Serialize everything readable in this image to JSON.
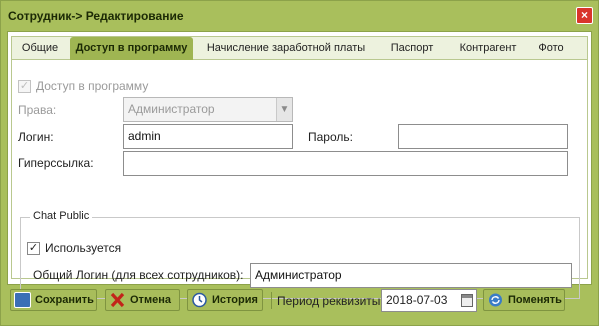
{
  "window": {
    "title": "Сотрудник-> Редактирование",
    "close": "×"
  },
  "tabs": [
    {
      "label": "Общие"
    },
    {
      "label": "Доступ в программу"
    },
    {
      "label": "Начисление заработной платы"
    },
    {
      "label": "Паспорт"
    },
    {
      "label": "Контрагент"
    },
    {
      "label": "Фото"
    }
  ],
  "form": {
    "access_label": "Доступ в программу",
    "rights_label": "Права:",
    "rights_value": "Администратор",
    "login_label": "Логин:",
    "login_value": "admin",
    "password_label": "Пароль:",
    "password_value": "",
    "hyperlink_label": "Гиперссылка:",
    "hyperlink_value": ""
  },
  "chat": {
    "legend": "Chat Public",
    "used_label": "Используется",
    "common_login_label": "Общий Логин (для всех сотрудников):",
    "common_login_value": "Администратор"
  },
  "footer": {
    "save_label": "Сохранить",
    "cancel_label": "Отмена",
    "history_label": "История",
    "period_label": "Период реквизиты:",
    "period_value": "2018-07-03",
    "change_label": "Поменять"
  }
}
